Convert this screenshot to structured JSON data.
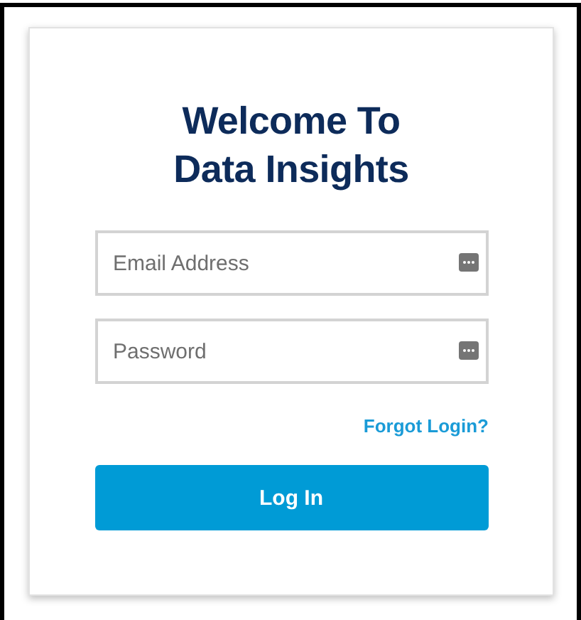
{
  "title": [
    "Welcome To",
    "Data Insights"
  ],
  "fields": [
    {
      "placeholder": "Email Address"
    },
    {
      "placeholder": "Password"
    }
  ],
  "forgot_link": "Forgot Login?",
  "submit_button": "Log In"
}
